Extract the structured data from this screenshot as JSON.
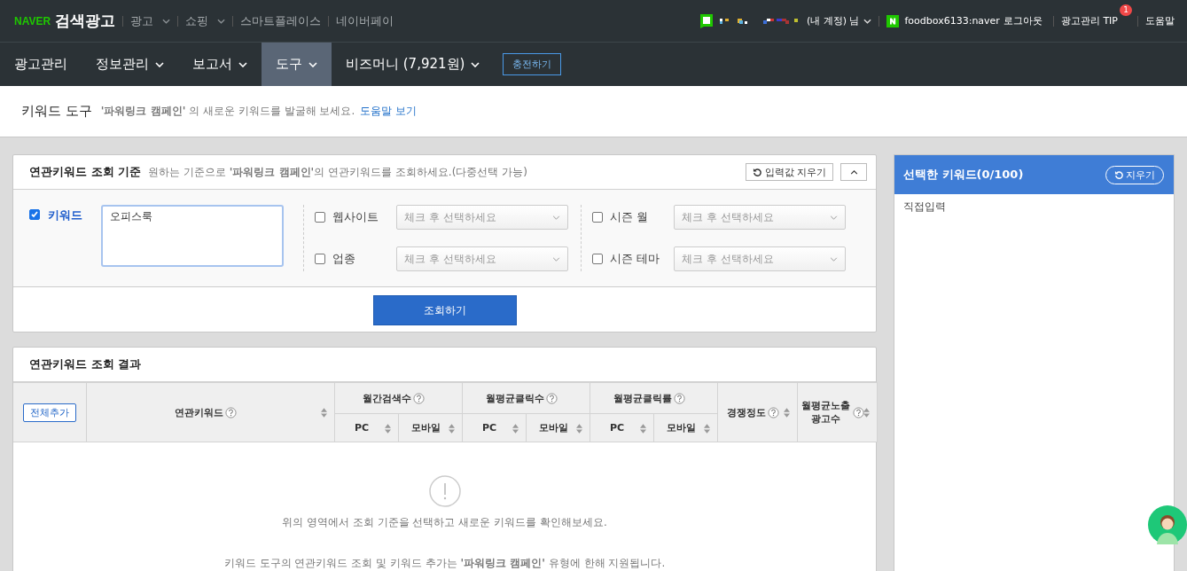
{
  "top_bar": {
    "logo_brand": "NAVER",
    "logo_title": "검색광고",
    "links": [
      {
        "label": "광고",
        "dropdown": true
      },
      {
        "label": "쇼핑",
        "dropdown": true
      },
      {
        "label": "스마트플레이스",
        "dropdown": false
      },
      {
        "label": "네이버페이",
        "dropdown": false
      }
    ],
    "account": "(내 계정) 님",
    "user": "foodbox6133:naver",
    "logout": "로그아웃",
    "tip": "광고관리 TIP",
    "tip_badge": "1",
    "help": "도움말"
  },
  "nav": {
    "items": [
      {
        "label": "광고관리",
        "dropdown": false,
        "selected": false
      },
      {
        "label": "정보관리",
        "dropdown": true,
        "selected": false
      },
      {
        "label": "보고서",
        "dropdown": true,
        "selected": false
      },
      {
        "label": "도구",
        "dropdown": true,
        "selected": true
      },
      {
        "label": "비즈머니 (7,921원)",
        "dropdown": true,
        "selected": false
      }
    ],
    "charge_button": "충전하기"
  },
  "page_header": {
    "title": "키워드 도구",
    "description": "**'파워링크 캠페인'** 의 새로운 키워드를 발굴해 보세요.",
    "help_link": "도움말 보기"
  },
  "criteria": {
    "title": "연관키워드 조회 기준",
    "description": "원하는 기준으로 **'파워링크 캠페인'**의 연관키워드를 조회하세요.(다중선택 가능)",
    "reset_button": "입력값 지우기",
    "keyword": {
      "label": "키워드",
      "checked": true,
      "value": "오피스룩"
    },
    "filter_columns": [
      [
        {
          "label": "웹사이트",
          "checked": false,
          "placeholder": "체크 후 선택하세요"
        },
        {
          "label": "업종",
          "checked": false,
          "placeholder": "체크 후 선택하세요"
        }
      ],
      [
        {
          "label": "시즌 월",
          "checked": false,
          "placeholder": "체크 후 선택하세요"
        },
        {
          "label": "시즌 테마",
          "checked": false,
          "placeholder": "체크 후 선택하세요"
        }
      ]
    ],
    "search_button": "조회하기"
  },
  "results": {
    "title": "연관키워드 조회 결과",
    "add_all_button": "전체추가",
    "columns": [
      {
        "label": "연관키워드",
        "help": true,
        "sortable": true
      },
      {
        "label": "월간검색수",
        "help": true,
        "sortable": false,
        "sub": [
          "PC",
          "모바일"
        ]
      },
      {
        "label": "월평균클릭수",
        "help": true,
        "sortable": false,
        "sub": [
          "PC",
          "모바일"
        ]
      },
      {
        "label": "월평균클릭률",
        "help": true,
        "sortable": false,
        "sub": [
          "PC",
          "모바일"
        ]
      },
      {
        "label": "경쟁정도",
        "help": true,
        "sortable": true
      },
      {
        "label": "월평균노출 광고수",
        "help": true,
        "sortable": true
      }
    ],
    "empty_message": "위의 영역에서 조회 기준을 선택하고 새로운 키워드를 확인해보세요.",
    "note": "키워드 도구의 연관키워드 조회 및 키워드 추가는 **'파워링크 캠페인'** 유형에 한해 지원됩니다."
  },
  "selected_panel": {
    "title": "선택한 키워드(0/100)",
    "clear_button": "지우기",
    "placeholder": "직접입력"
  }
}
